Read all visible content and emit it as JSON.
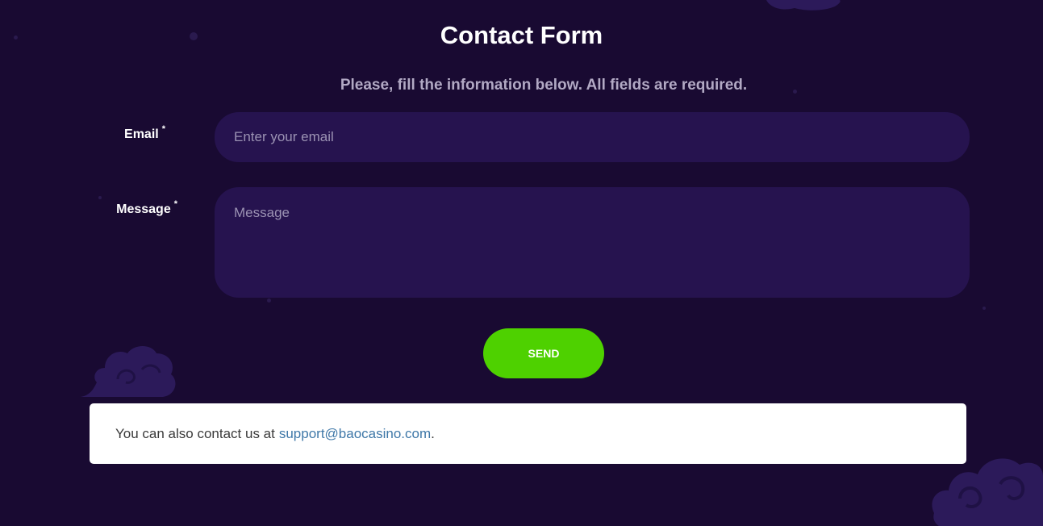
{
  "form": {
    "title": "Contact Form",
    "subtitle": "Please, fill the information below. All fields are required.",
    "required_mark": "*",
    "email": {
      "label": "Email",
      "placeholder": "Enter your email",
      "value": ""
    },
    "message": {
      "label": "Message",
      "placeholder": "Message",
      "value": ""
    },
    "send_label": "SEND"
  },
  "contact_note": {
    "text": "You can also contact us at",
    "email_link": "support@baocasino.com",
    "suffix": "."
  },
  "colors": {
    "background": "#190a32",
    "input_bg": "#26134f",
    "send_button": "#4ed100",
    "link": "#3f78a8"
  }
}
